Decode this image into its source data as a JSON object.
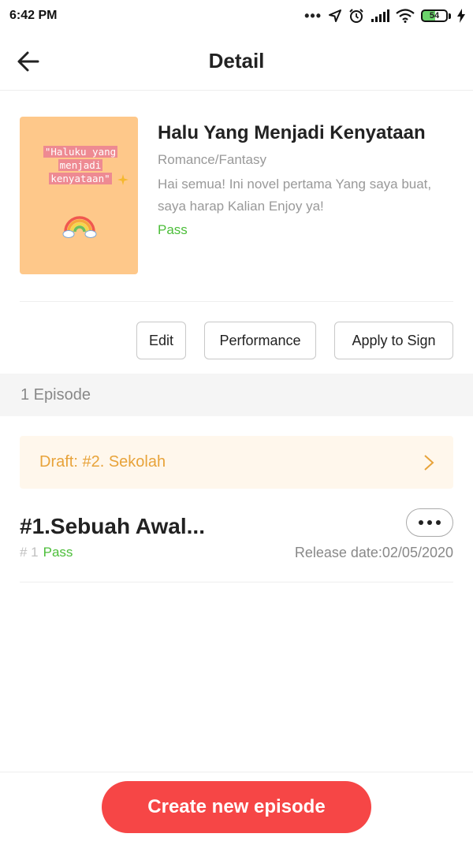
{
  "status_bar": {
    "time": "6:42 PM",
    "battery": "54",
    "icons": [
      "more-dots-icon",
      "location-arrow-icon",
      "alarm-icon",
      "signal-icon",
      "wifi-icon",
      "battery-icon",
      "charging-icon"
    ]
  },
  "header": {
    "title": "Detail",
    "back_icon": "arrow-left-icon"
  },
  "book": {
    "cover_lines": [
      "\"Haluku yang",
      "menjadi",
      "kenyataan\""
    ],
    "title": "Halu Yang Menjadi Kenyataan",
    "genre": "Romance/Fantasy",
    "description": "Hai semua! Ini novel pertama Yang saya buat, saya harap Kalian Enjoy ya!",
    "status": "Pass"
  },
  "actions": {
    "edit_label": "Edit",
    "performance_label": "Performance",
    "apply_label": "Apply to Sign"
  },
  "episodes": {
    "count_label": "1 Episode",
    "draft_label": "Draft: #2. Sekolah",
    "items": [
      {
        "title": "#1.Sebuah Awal...",
        "number": "# 1",
        "status": "Pass",
        "release": "Release date:02/05/2020"
      }
    ]
  },
  "footer": {
    "create_label": "Create new episode"
  },
  "colors": {
    "accent": "#f64646",
    "pass": "#4cbe3a",
    "draft": "#e8a33a",
    "draft_bg": "#fff7ec",
    "cover_bg": "#fec88a"
  }
}
